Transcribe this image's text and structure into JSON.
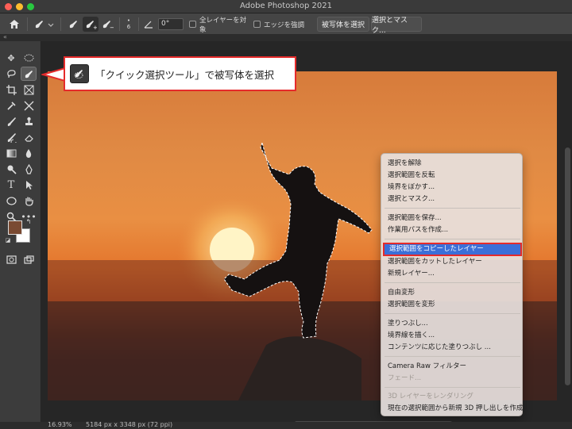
{
  "window": {
    "title": "Adobe Photoshop 2021"
  },
  "options_bar": {
    "angle_value": "0°",
    "sample_all_layers_label": "全レイヤーを対象",
    "enhance_edge_label": "エッジを強調",
    "select_subject_label": "被写体を選択",
    "select_and_mask_label": "選択とマスク...",
    "brush_size_small": "6"
  },
  "status_bar": {
    "zoom": "16.93%",
    "dimensions": "5184 px x 3348 px (72 ppi)"
  },
  "callout": {
    "text": "「クイック選択ツール」で被写体を選択"
  },
  "context_menu": {
    "items": [
      {
        "label": "選択を解除"
      },
      {
        "label": "選択範囲を反転"
      },
      {
        "label": "境界をぼかす..."
      },
      {
        "label": "選択とマスク..."
      },
      {
        "label": "選択範囲を保存..."
      },
      {
        "label": "作業用パスを作成..."
      },
      {
        "label": "選択範囲をコピーしたレイヤー"
      },
      {
        "label": "選択範囲をカットしたレイヤー"
      },
      {
        "label": "新規レイヤー..."
      },
      {
        "label": "自由変形"
      },
      {
        "label": "選択範囲を変形"
      },
      {
        "label": "塗りつぶし..."
      },
      {
        "label": "境界線を描く..."
      },
      {
        "label": "コンテンツに応じた塗りつぶし ..."
      },
      {
        "label": "Camera Raw フィルター"
      },
      {
        "label": "フェード..."
      },
      {
        "label": "3D レイヤーをレンダリング"
      },
      {
        "label": "現在の選択範囲から新規 3D 押し出しを作成"
      }
    ]
  },
  "colors": {
    "foreground": "#7a4a32",
    "background": "#ffffff",
    "highlight": "#3b6fd8",
    "callout_border": "#e52b2b"
  }
}
